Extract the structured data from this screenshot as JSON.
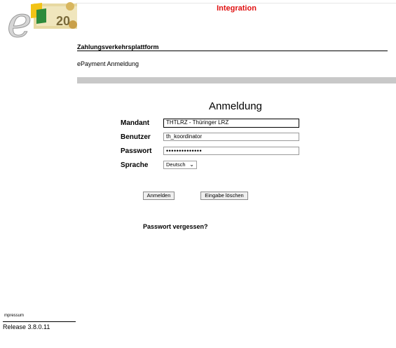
{
  "environment_label": "Integration",
  "logo": {
    "letter": "e",
    "badge_text": "20"
  },
  "header": {
    "platform": "Zahlungsverkehrsplattform",
    "subtitle": "ePayment Anmeldung"
  },
  "form": {
    "title": "Anmeldung",
    "mandant_label": "Mandant",
    "mandant_value": "THTLRZ - Thüringer LRZ",
    "benutzer_label": "Benutzer",
    "benutzer_value": "th_koordinator",
    "passwort_label": "Passwort",
    "passwort_value": "••••••••••••••",
    "sprache_label": "Sprache",
    "sprache_value": "Deutsch"
  },
  "buttons": {
    "login": "Anmelden",
    "clear": "Eingabe löschen"
  },
  "forgot_password": "Passwort vergessen?",
  "footer": {
    "impressum": "mpressum",
    "release": "Release 3.8.0.11"
  },
  "colors": {
    "environment": "#e01010",
    "gray_bar": "#c8c8c8"
  }
}
